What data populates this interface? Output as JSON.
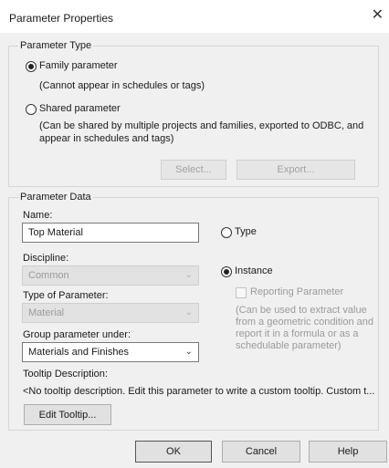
{
  "dialog": {
    "title": "Parameter Properties",
    "close_glyph": "✕"
  },
  "parameter_type": {
    "legend": "Parameter Type",
    "family_label": "Family parameter",
    "family_note": "(Cannot appear in schedules or tags)",
    "shared_label": "Shared parameter",
    "shared_note_line1": "(Can be shared by multiple projects and families, exported to ODBC, and",
    "shared_note_line2": "appear in schedules and tags)",
    "select_button": "Select...",
    "export_button": "Export...",
    "selected": "family"
  },
  "parameter_data": {
    "legend": "Parameter Data",
    "name_label": "Name:",
    "name_value": "Top Material",
    "type_label": "Type",
    "instance_label": "Instance",
    "selected_scope": "instance",
    "discipline_label": "Discipline:",
    "discipline_value": "Common",
    "type_of_parameter_label": "Type of Parameter:",
    "type_of_parameter_value": "Material",
    "reporting_label": "Reporting Parameter",
    "reporting_checked": false,
    "reporting_note_line1": "(Can be used to extract value",
    "reporting_note_line2": "from a geometric condition and",
    "reporting_note_line3": "report it in a formula or as a",
    "reporting_note_line4": "schedulable parameter)",
    "group_label": "Group parameter under:",
    "group_value": "Materials and Finishes",
    "tooltip_label": "Tooltip Description:",
    "tooltip_text": "<No tooltip description. Edit this parameter to write a custom tooltip. Custom t...",
    "edit_tooltip_button": "Edit Tooltip..."
  },
  "footer": {
    "ok": "OK",
    "cancel": "Cancel",
    "help": "Help"
  },
  "icons": {
    "dropdown": "chevron-down-icon",
    "close": "close-icon"
  }
}
